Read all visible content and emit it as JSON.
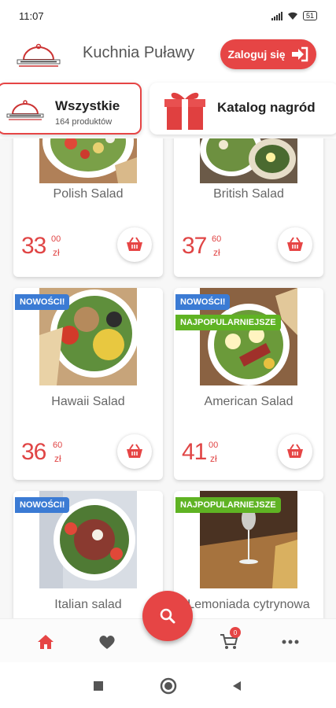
{
  "status": {
    "time": "11:07",
    "battery": "51"
  },
  "header": {
    "shop_name": "Kuchnia Puławy",
    "login_label": "Zaloguj się",
    "logo_icon": "restaurant-cloche-logo"
  },
  "tabs": {
    "all": {
      "title": "Wszystkie",
      "subtitle": "164 produktów"
    },
    "rewards": {
      "title": "Katalog nagród",
      "icon": "gift-icon"
    }
  },
  "products": [
    {
      "name": "Polish Salad",
      "price_main": "33",
      "price_cents": "00",
      "currency": "zł",
      "badges": []
    },
    {
      "name": "British Salad",
      "price_main": "37",
      "price_cents": "60",
      "currency": "zł",
      "badges": []
    },
    {
      "name": "Hawaii Salad",
      "price_main": "36",
      "price_cents": "60",
      "currency": "zł",
      "badges": [
        "NOWOŚCI!"
      ]
    },
    {
      "name": "American Salad",
      "price_main": "41",
      "price_cents": "00",
      "currency": "zł",
      "badges": [
        "NOWOŚCI!",
        "NAJPOPULARNIEJSZE"
      ]
    },
    {
      "name": "Italian salad",
      "badges": [
        "NOWOŚCI!"
      ]
    },
    {
      "name": "Lemoniada cytrynowa",
      "badges": [
        "NAJPOPULARNIEJSZE"
      ]
    }
  ],
  "bottom_nav": {
    "cart_count": "0"
  },
  "colors": {
    "accent": "#e64545",
    "badge_new": "#3b7bd4",
    "badge_popular": "#5fb323",
    "price": "#e04545"
  }
}
